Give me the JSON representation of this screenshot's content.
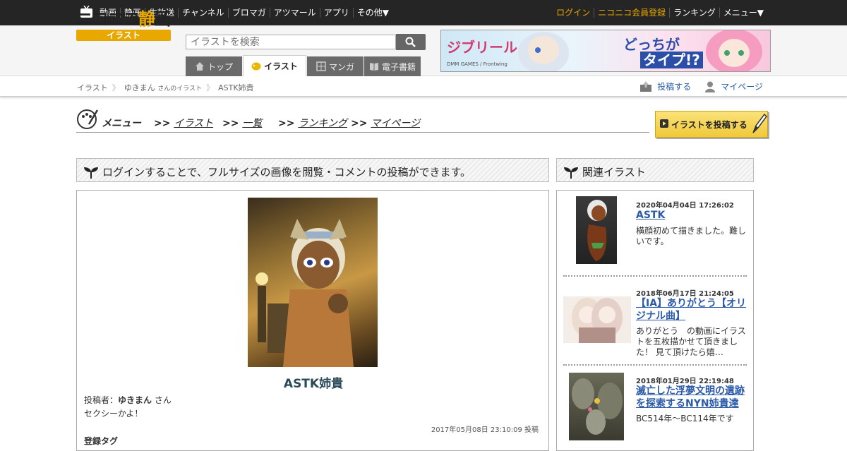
{
  "topnav": {
    "left": [
      "動画",
      "静画",
      "生放送",
      "チャンネル",
      "ブロマガ",
      "アツマール",
      "アプリ",
      "その他▼"
    ],
    "login": "ログイン",
    "register": "ニコニコ会員登録",
    "ranking": "ランキング",
    "menu": "メニュー▼"
  },
  "header": {
    "logo_main": "ニコニコ",
    "logo_accent": "静",
    "logo_end": "画",
    "logo_sub": "イラスト",
    "search_placeholder": "イラストを検索",
    "tabs": [
      "トップ",
      "イラスト",
      "マンガ",
      "電子書籍"
    ],
    "banner": {
      "text1": "ジブリール",
      "text2": "どっちが",
      "text3": "タイプ!?",
      "small": "DMM GAMES / Frontwing"
    }
  },
  "breadcrumb": {
    "root": "イラスト",
    "user": "ゆきまん",
    "user_suffix": "さんのイラスト",
    "current": "ASTK姉貴",
    "post_label": "投稿する",
    "mypage_label": "マイページ"
  },
  "menu": {
    "title": "メニュー",
    "prefix": ">>",
    "links": [
      "イラスト",
      "一覧",
      "ランキング",
      "マイページ"
    ],
    "post_button": "イラストを投稿する"
  },
  "main": {
    "notice": "ログインすることで、フルサイズの画像を閲覧・コメントの投稿ができます。",
    "title": "ASTK姉貴",
    "poster_label": "投稿者：",
    "poster_name": "ゆきまん",
    "poster_suffix": "さん",
    "description": "セクシーかよ！",
    "posted_at": "2017年05月08日 23:10:09 投稿",
    "tags_label": "登録タグ"
  },
  "related": {
    "heading": "関連イラスト",
    "items": [
      {
        "date": "2020年04月04日 17:26:02",
        "title": "ASTK",
        "desc": "横顔初めて描きました。難しいです。"
      },
      {
        "date": "2018年06月17日 21:24:05",
        "title": "【IA】ありがとう【オリジナル曲】",
        "desc": "ありがとう　の動画にイラストを五枚描かせて頂きました！ 見て頂けたら嬉…"
      },
      {
        "date": "2018年01月29日 22:19:48",
        "title": "滅亡した浮夢文明の遺跡を探索するNYN姉貴達",
        "desc": "BC514年～BC114年です"
      }
    ]
  },
  "colors": {
    "topbar": "#252525",
    "accent": "#e8a800",
    "link": "#2a5aa8"
  }
}
